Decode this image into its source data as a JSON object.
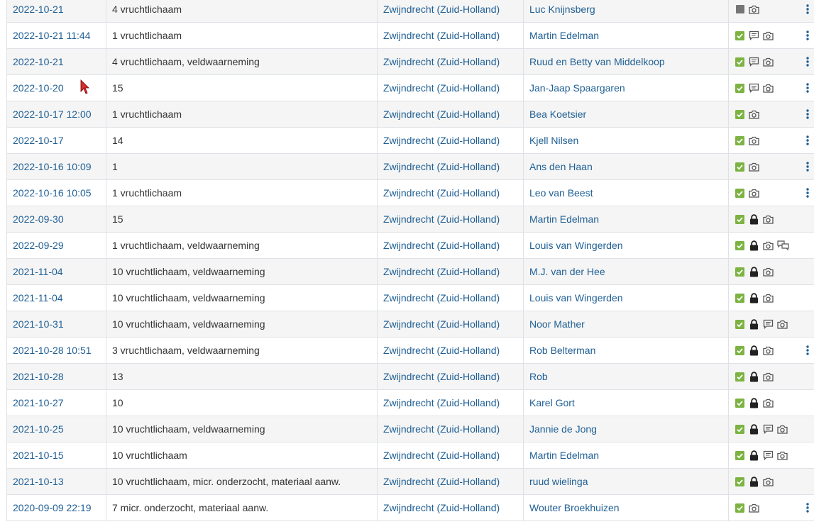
{
  "colors": {
    "link": "#1f5f94",
    "validated": "#7cb342",
    "pending": "#757575",
    "icon": "#555555",
    "menu": "#1f5f94"
  },
  "rows": [
    {
      "date": "2022-10-21",
      "qty": "4 vruchtlichaam",
      "loc": "Zwijndrecht (Zuid-Holland)",
      "observer": "Luc Knijnsberg",
      "status": "pending",
      "lock": false,
      "comment": false,
      "photo": true,
      "discussion": false,
      "menu": true
    },
    {
      "date": "2022-10-21 11:44",
      "qty": "1 vruchtlichaam",
      "loc": "Zwijndrecht (Zuid-Holland)",
      "observer": "Martin Edelman",
      "status": "validated",
      "lock": false,
      "comment": true,
      "photo": true,
      "discussion": false,
      "menu": true
    },
    {
      "date": "2022-10-21",
      "qty": "4 vruchtlichaam, veldwaarneming",
      "loc": "Zwijndrecht (Zuid-Holland)",
      "observer": "Ruud en Betty van Middelkoop",
      "status": "validated",
      "lock": false,
      "comment": true,
      "photo": true,
      "discussion": false,
      "menu": true
    },
    {
      "date": "2022-10-20",
      "qty": "15",
      "loc": "Zwijndrecht (Zuid-Holland)",
      "observer": "Jan-Jaap Spaargaren",
      "status": "validated",
      "lock": false,
      "comment": true,
      "photo": true,
      "discussion": false,
      "menu": true
    },
    {
      "date": "2022-10-17 12:00",
      "qty": "1 vruchtlichaam",
      "loc": "Zwijndrecht (Zuid-Holland)",
      "observer": "Bea Koetsier",
      "status": "validated",
      "lock": false,
      "comment": false,
      "photo": true,
      "discussion": false,
      "menu": true
    },
    {
      "date": "2022-10-17",
      "qty": "14",
      "loc": "Zwijndrecht (Zuid-Holland)",
      "observer": "Kjell Nilsen",
      "status": "validated",
      "lock": false,
      "comment": false,
      "photo": true,
      "discussion": false,
      "menu": true
    },
    {
      "date": "2022-10-16 10:09",
      "qty": "1",
      "loc": "Zwijndrecht (Zuid-Holland)",
      "observer": "Ans den Haan",
      "status": "validated",
      "lock": false,
      "comment": false,
      "photo": true,
      "discussion": false,
      "menu": true
    },
    {
      "date": "2022-10-16 10:05",
      "qty": "1 vruchtlichaam",
      "loc": "Zwijndrecht (Zuid-Holland)",
      "observer": "Leo van Beest",
      "status": "validated",
      "lock": false,
      "comment": false,
      "photo": true,
      "discussion": false,
      "menu": true
    },
    {
      "date": "2022-09-30",
      "qty": "15",
      "loc": "Zwijndrecht (Zuid-Holland)",
      "observer": "Martin Edelman",
      "status": "validated",
      "lock": true,
      "comment": false,
      "photo": true,
      "discussion": false,
      "menu": false
    },
    {
      "date": "2022-09-29",
      "qty": "1 vruchtlichaam, veldwaarneming",
      "loc": "Zwijndrecht (Zuid-Holland)",
      "observer": "Louis van Wingerden",
      "status": "validated",
      "lock": true,
      "comment": false,
      "photo": true,
      "discussion": true,
      "menu": false
    },
    {
      "date": "2021-11-04",
      "qty": "10 vruchtlichaam, veldwaarneming",
      "loc": "Zwijndrecht (Zuid-Holland)",
      "observer": "M.J. van der Hee",
      "status": "validated",
      "lock": true,
      "comment": false,
      "photo": true,
      "discussion": false,
      "menu": false
    },
    {
      "date": "2021-11-04",
      "qty": "10 vruchtlichaam, veldwaarneming",
      "loc": "Zwijndrecht (Zuid-Holland)",
      "observer": "Louis van Wingerden",
      "status": "validated",
      "lock": true,
      "comment": false,
      "photo": true,
      "discussion": false,
      "menu": false
    },
    {
      "date": "2021-10-31",
      "qty": "10 vruchtlichaam, veldwaarneming",
      "loc": "Zwijndrecht (Zuid-Holland)",
      "observer": "Noor Mather",
      "status": "validated",
      "lock": true,
      "comment": true,
      "photo": true,
      "discussion": false,
      "menu": false
    },
    {
      "date": "2021-10-28 10:51",
      "qty": "3 vruchtlichaam, veldwaarneming",
      "loc": "Zwijndrecht (Zuid-Holland)",
      "observer": "Rob Belterman",
      "status": "validated",
      "lock": true,
      "comment": false,
      "photo": true,
      "discussion": false,
      "menu": true
    },
    {
      "date": "2021-10-28",
      "qty": "13",
      "loc": "Zwijndrecht (Zuid-Holland)",
      "observer": "Rob",
      "status": "validated",
      "lock": true,
      "comment": false,
      "photo": true,
      "discussion": false,
      "menu": false
    },
    {
      "date": "2021-10-27",
      "qty": "10",
      "loc": "Zwijndrecht (Zuid-Holland)",
      "observer": "Karel Gort",
      "status": "validated",
      "lock": true,
      "comment": false,
      "photo": true,
      "discussion": false,
      "menu": false
    },
    {
      "date": "2021-10-25",
      "qty": "10 vruchtlichaam, veldwaarneming",
      "loc": "Zwijndrecht (Zuid-Holland)",
      "observer": "Jannie de Jong",
      "status": "validated",
      "lock": true,
      "comment": true,
      "photo": true,
      "discussion": false,
      "menu": false
    },
    {
      "date": "2021-10-15",
      "qty": "10 vruchtlichaam",
      "loc": "Zwijndrecht (Zuid-Holland)",
      "observer": "Martin Edelman",
      "status": "validated",
      "lock": true,
      "comment": true,
      "photo": true,
      "discussion": false,
      "menu": false
    },
    {
      "date": "2021-10-13",
      "qty": "10 vruchtlichaam, micr. onderzocht, materiaal aanw.",
      "loc": "Zwijndrecht (Zuid-Holland)",
      "observer": "ruud wielinga",
      "status": "validated",
      "lock": true,
      "comment": false,
      "photo": true,
      "discussion": false,
      "menu": false
    },
    {
      "date": "2020-09-09 22:19",
      "qty": "7 micr. onderzocht, materiaal aanw.",
      "loc": "Zwijndrecht (Zuid-Holland)",
      "observer": "Wouter Broekhuizen",
      "status": "validated",
      "lock": false,
      "comment": false,
      "photo": true,
      "discussion": false,
      "menu": true
    }
  ]
}
